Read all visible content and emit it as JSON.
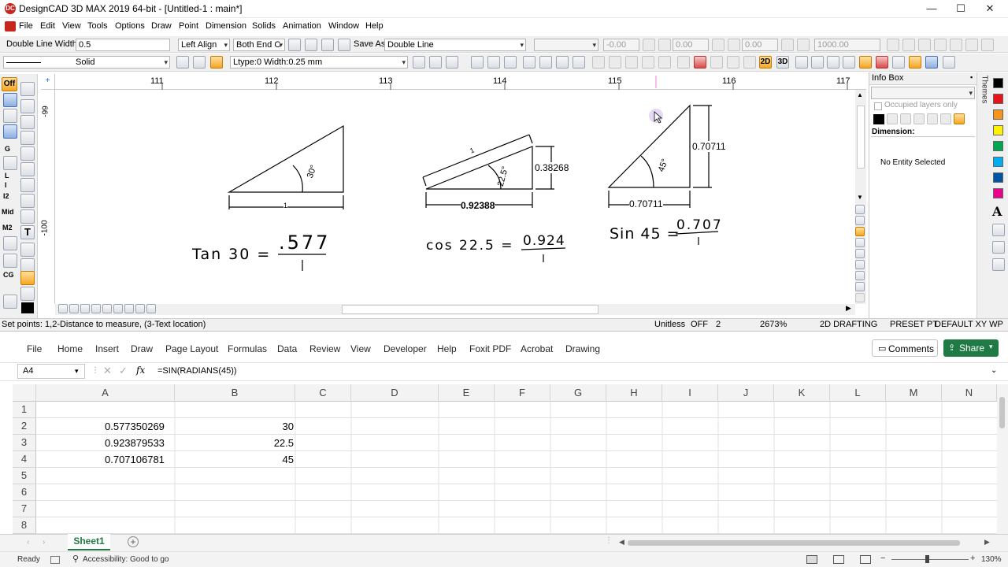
{
  "cad": {
    "window_title": "DesignCAD 3D MAX 2019 64-bit - [Untitled-1 : main*]",
    "logo_text": "DC",
    "window_controls": {
      "minimize": "—",
      "maximize": "☐",
      "close": "✕"
    },
    "menu": [
      "File",
      "Edit",
      "View",
      "Tools",
      "Options",
      "Draw",
      "Point",
      "Dimension",
      "Solids",
      "Animation",
      "Window",
      "Help"
    ],
    "toolbar1": {
      "dl_label": "Double Line Width:",
      "dl_value": "0.5",
      "align": "Left Align",
      "end_caps": "Both End C",
      "save_as_label": "Save As:",
      "save_as_value": "Double Line",
      "x_field": "-0.00",
      "y_field": "0.00",
      "z_field": "0.00",
      "scale_field": "1000.00"
    },
    "toolbar2": {
      "line_style": "Solid",
      "ltype_label": "Ltype:0  Width:0.25 mm",
      "btn_2d": "2D",
      "btn_3d": "3D"
    },
    "left_tool_labels": [
      "Off",
      "G",
      "L",
      "I",
      "I2",
      "Mid",
      "M2",
      "CG"
    ],
    "ruler_top": [
      "111",
      "112",
      "113",
      "114",
      "115",
      "116",
      "117"
    ],
    "ruler_left": [
      "-99",
      "-100"
    ],
    "drawing": {
      "tri1": {
        "angle": "30°",
        "base": "1",
        "equation": "Tan 30 =",
        "numerator": ".577",
        "denominator": "1"
      },
      "tri2": {
        "hyp": "1",
        "angle": "22.5°",
        "opp": "0.38268",
        "base": "0.92388",
        "equation": "cos 22.5 =",
        "numerator": "0.924",
        "denominator": "1"
      },
      "tri3": {
        "angle": "45°",
        "opp": "0.70711",
        "base": "0.70711",
        "equation": "Sin 45 =",
        "numerator": "0.707",
        "denominator": "1"
      }
    },
    "info_box": {
      "title": "Info Box",
      "occupied_layers": "Occupied layers only",
      "dimension_label": "Dimension:",
      "selection": "No Entity Selected"
    },
    "themes_label": "Themes",
    "palette_colors": [
      "#000000",
      "#e8141c",
      "#f7941d",
      "#fff200",
      "#00a650",
      "#00aeef",
      "#0054a6",
      "#ec008c"
    ],
    "status": {
      "prompt": "Set points: 1,2-Distance to measure, (3-Text location)",
      "units": "Unitless",
      "snap": "OFF",
      "count": "2",
      "zoom": "2673%",
      "mode": "2D DRAFTING",
      "preset": "PRESET PT",
      "view": "DEFAULT XY WP"
    }
  },
  "excel": {
    "tabs": [
      "File",
      "Home",
      "Insert",
      "Draw",
      "Page Layout",
      "Formulas",
      "Data",
      "Review",
      "View",
      "Developer",
      "Help",
      "Foxit PDF",
      "Acrobat",
      "Drawing"
    ],
    "comments_label": "Comments",
    "share_label": "Share",
    "name_box": "A4",
    "formula": "=SIN(RADIANS(45))",
    "fx_label": "fx",
    "columns": [
      "A",
      "B",
      "C",
      "D",
      "E",
      "F",
      "G",
      "H",
      "I",
      "J",
      "K",
      "L",
      "M",
      "N"
    ],
    "rows": [
      "1",
      "2",
      "3",
      "4",
      "5",
      "6",
      "7",
      "8"
    ],
    "cells": {
      "a2": "0.577350269",
      "b2": "30",
      "a3": "0.923879533",
      "b3": "22.5",
      "a4": "0.707106781",
      "b4": "45"
    },
    "sheet_tab": "Sheet1",
    "add_sheet": "+",
    "status_ready": "Ready",
    "status_accessibility": "Accessibility: Good to go",
    "zoom": "130%"
  }
}
